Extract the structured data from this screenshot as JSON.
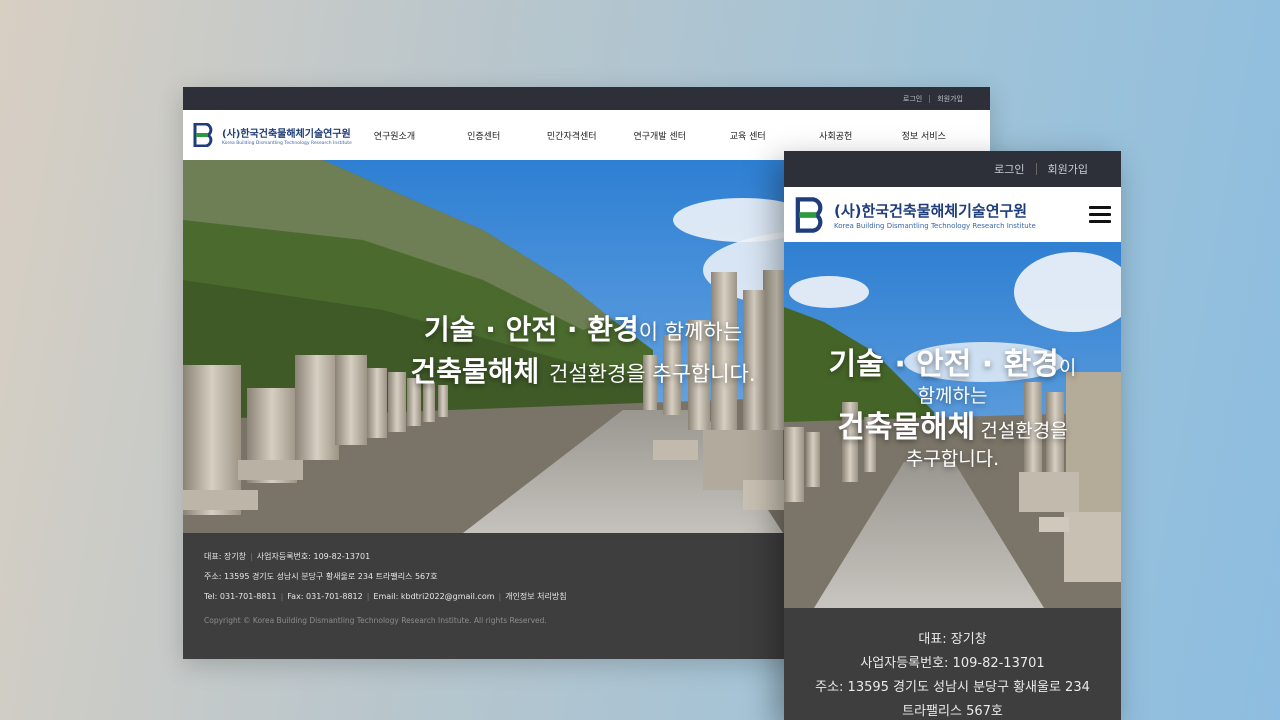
{
  "brand": {
    "name_ko": "(사)한국건축물해체기술연구원",
    "name_en": "Korea Building Dismantling Technology Research Institute",
    "color_primary": "#1f3d7a",
    "color_accent": "#2e9a3e"
  },
  "util_links": {
    "login": "로그인",
    "signup": "회원가입"
  },
  "menu": [
    "연구원소개",
    "인증센터",
    "민간자격센터",
    "연구개발 센터",
    "교육 센터",
    "사회공헌",
    "정보 서비스"
  ],
  "hero": {
    "line1_main": "기술 · 안전 · 환경",
    "line1_rest": "이 함께하는",
    "line2_main": "건축물해체",
    "line2_rest": "건설환경을 추구합니다.",
    "mobile_line1_main": "기술 · 안전 · 환경",
    "mobile_line1_rest": "이",
    "mobile_line2": "함께하는",
    "mobile_line3_main": "건축물해체",
    "mobile_line3_rest": "건설환경을",
    "mobile_line4": "추구합니다."
  },
  "footer": {
    "rep": "대표: 장기창",
    "biz_no": "사업자등록번호: 109-82-13701",
    "address": "주소: 13595 경기도 성남시 분당구 황새울로 234 트라팰리스 567호",
    "tel": "Tel: 031-701-8811",
    "fax": "Fax: 031-701-8812",
    "email": "Email: kbdtri2022@gmail.com",
    "privacy": "개인정보 처리방침",
    "copyright": "Copyright © Korea Building Dismantling Technology Research Institute. All rights Reserved.",
    "mobile_address_1": "주소: 13595 경기도 성남시 분당구 황새울로 234",
    "mobile_address_2": "트라팰리스 567호"
  }
}
